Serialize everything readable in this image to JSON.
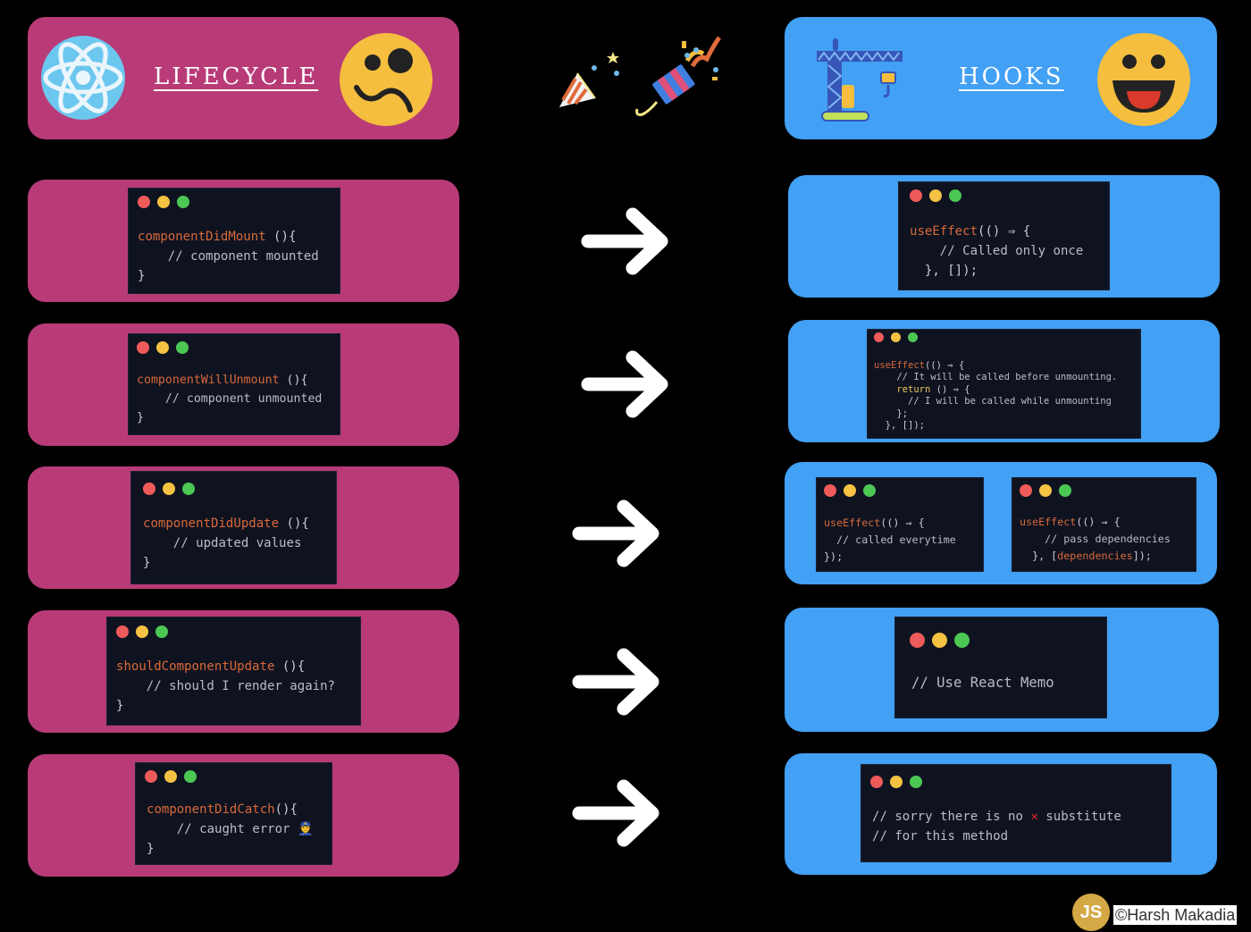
{
  "header": {
    "left_title": "LIFECYCLE",
    "right_title": "HOOKS",
    "left_icons": [
      "react-atom-icon",
      "confused-face-icon"
    ],
    "right_icons": [
      "crane-icon",
      "grinning-face-icon"
    ],
    "center_icons": [
      "party-popper-icon",
      "confetti-popper-icon"
    ]
  },
  "colors": {
    "lifecycle_panel": "#b83b77",
    "hooks_panel": "#42a0f5",
    "code_bg": "#0f1320",
    "function_name": "#d9693a",
    "keyword": "#e8c65a",
    "comment": "#b9bdc7"
  },
  "rows": [
    {
      "lifecycle": {
        "fn": "componentDidMount",
        "sig": " (){",
        "comment": "    // component mounted",
        "close": "}"
      },
      "hooks": [
        {
          "lines": [
            {
              "fn": "useEffect",
              "rest": "(() ⇒ {"
            },
            {
              "text": "    // Called only once"
            },
            {
              "text": "  }, []);"
            }
          ]
        }
      ]
    },
    {
      "lifecycle": {
        "fn": "componentWillUnmount",
        "sig": " (){",
        "comment": "    // component unmounted",
        "close": "}"
      },
      "hooks": [
        {
          "lines": [
            {
              "fn": "useEffect",
              "rest": "(() ⇒ {"
            },
            {
              "text": "    // It will be called before unmounting."
            },
            {
              "kw": "    return",
              "rest": " () ⇒ {"
            },
            {
              "text": "      // I will be called while unmounting"
            },
            {
              "text": "    };"
            },
            {
              "text": "  }, []);"
            }
          ]
        }
      ]
    },
    {
      "lifecycle": {
        "fn": "componentDidUpdate",
        "sig": " (){",
        "comment": "    // updated values",
        "close": "}"
      },
      "hooks": [
        {
          "lines": [
            {
              "fn": "useEffect",
              "rest": "(() ⇒ {"
            },
            {
              "text": "  // called everytime"
            },
            {
              "text": "});"
            }
          ]
        },
        {
          "lines": [
            {
              "fn": "useEffect",
              "rest": "(() ⇒ {"
            },
            {
              "text": "    // pass dependencies"
            },
            {
              "pre": "  }, [",
              "dep": "dependencies",
              "post": "]);"
            }
          ]
        }
      ]
    },
    {
      "lifecycle": {
        "fn": "shouldComponentUpdate",
        "sig": " (){",
        "comment": "    // should I render again?",
        "close": "}"
      },
      "hooks": [
        {
          "lines": [
            {
              "text": "// Use React Memo"
            }
          ]
        }
      ]
    },
    {
      "lifecycle": {
        "fn": "componentDidCatch",
        "sig": "(){",
        "comment": "    // caught error 👮",
        "close": "}"
      },
      "hooks": [
        {
          "lines": [
            {
              "pre": "// sorry there is no ",
              "mark": "✕",
              "post": " substitute"
            },
            {
              "text": "// for this method"
            }
          ]
        }
      ]
    }
  ],
  "watermark": {
    "badge": "JS",
    "text": "©Harsh Makadia"
  }
}
